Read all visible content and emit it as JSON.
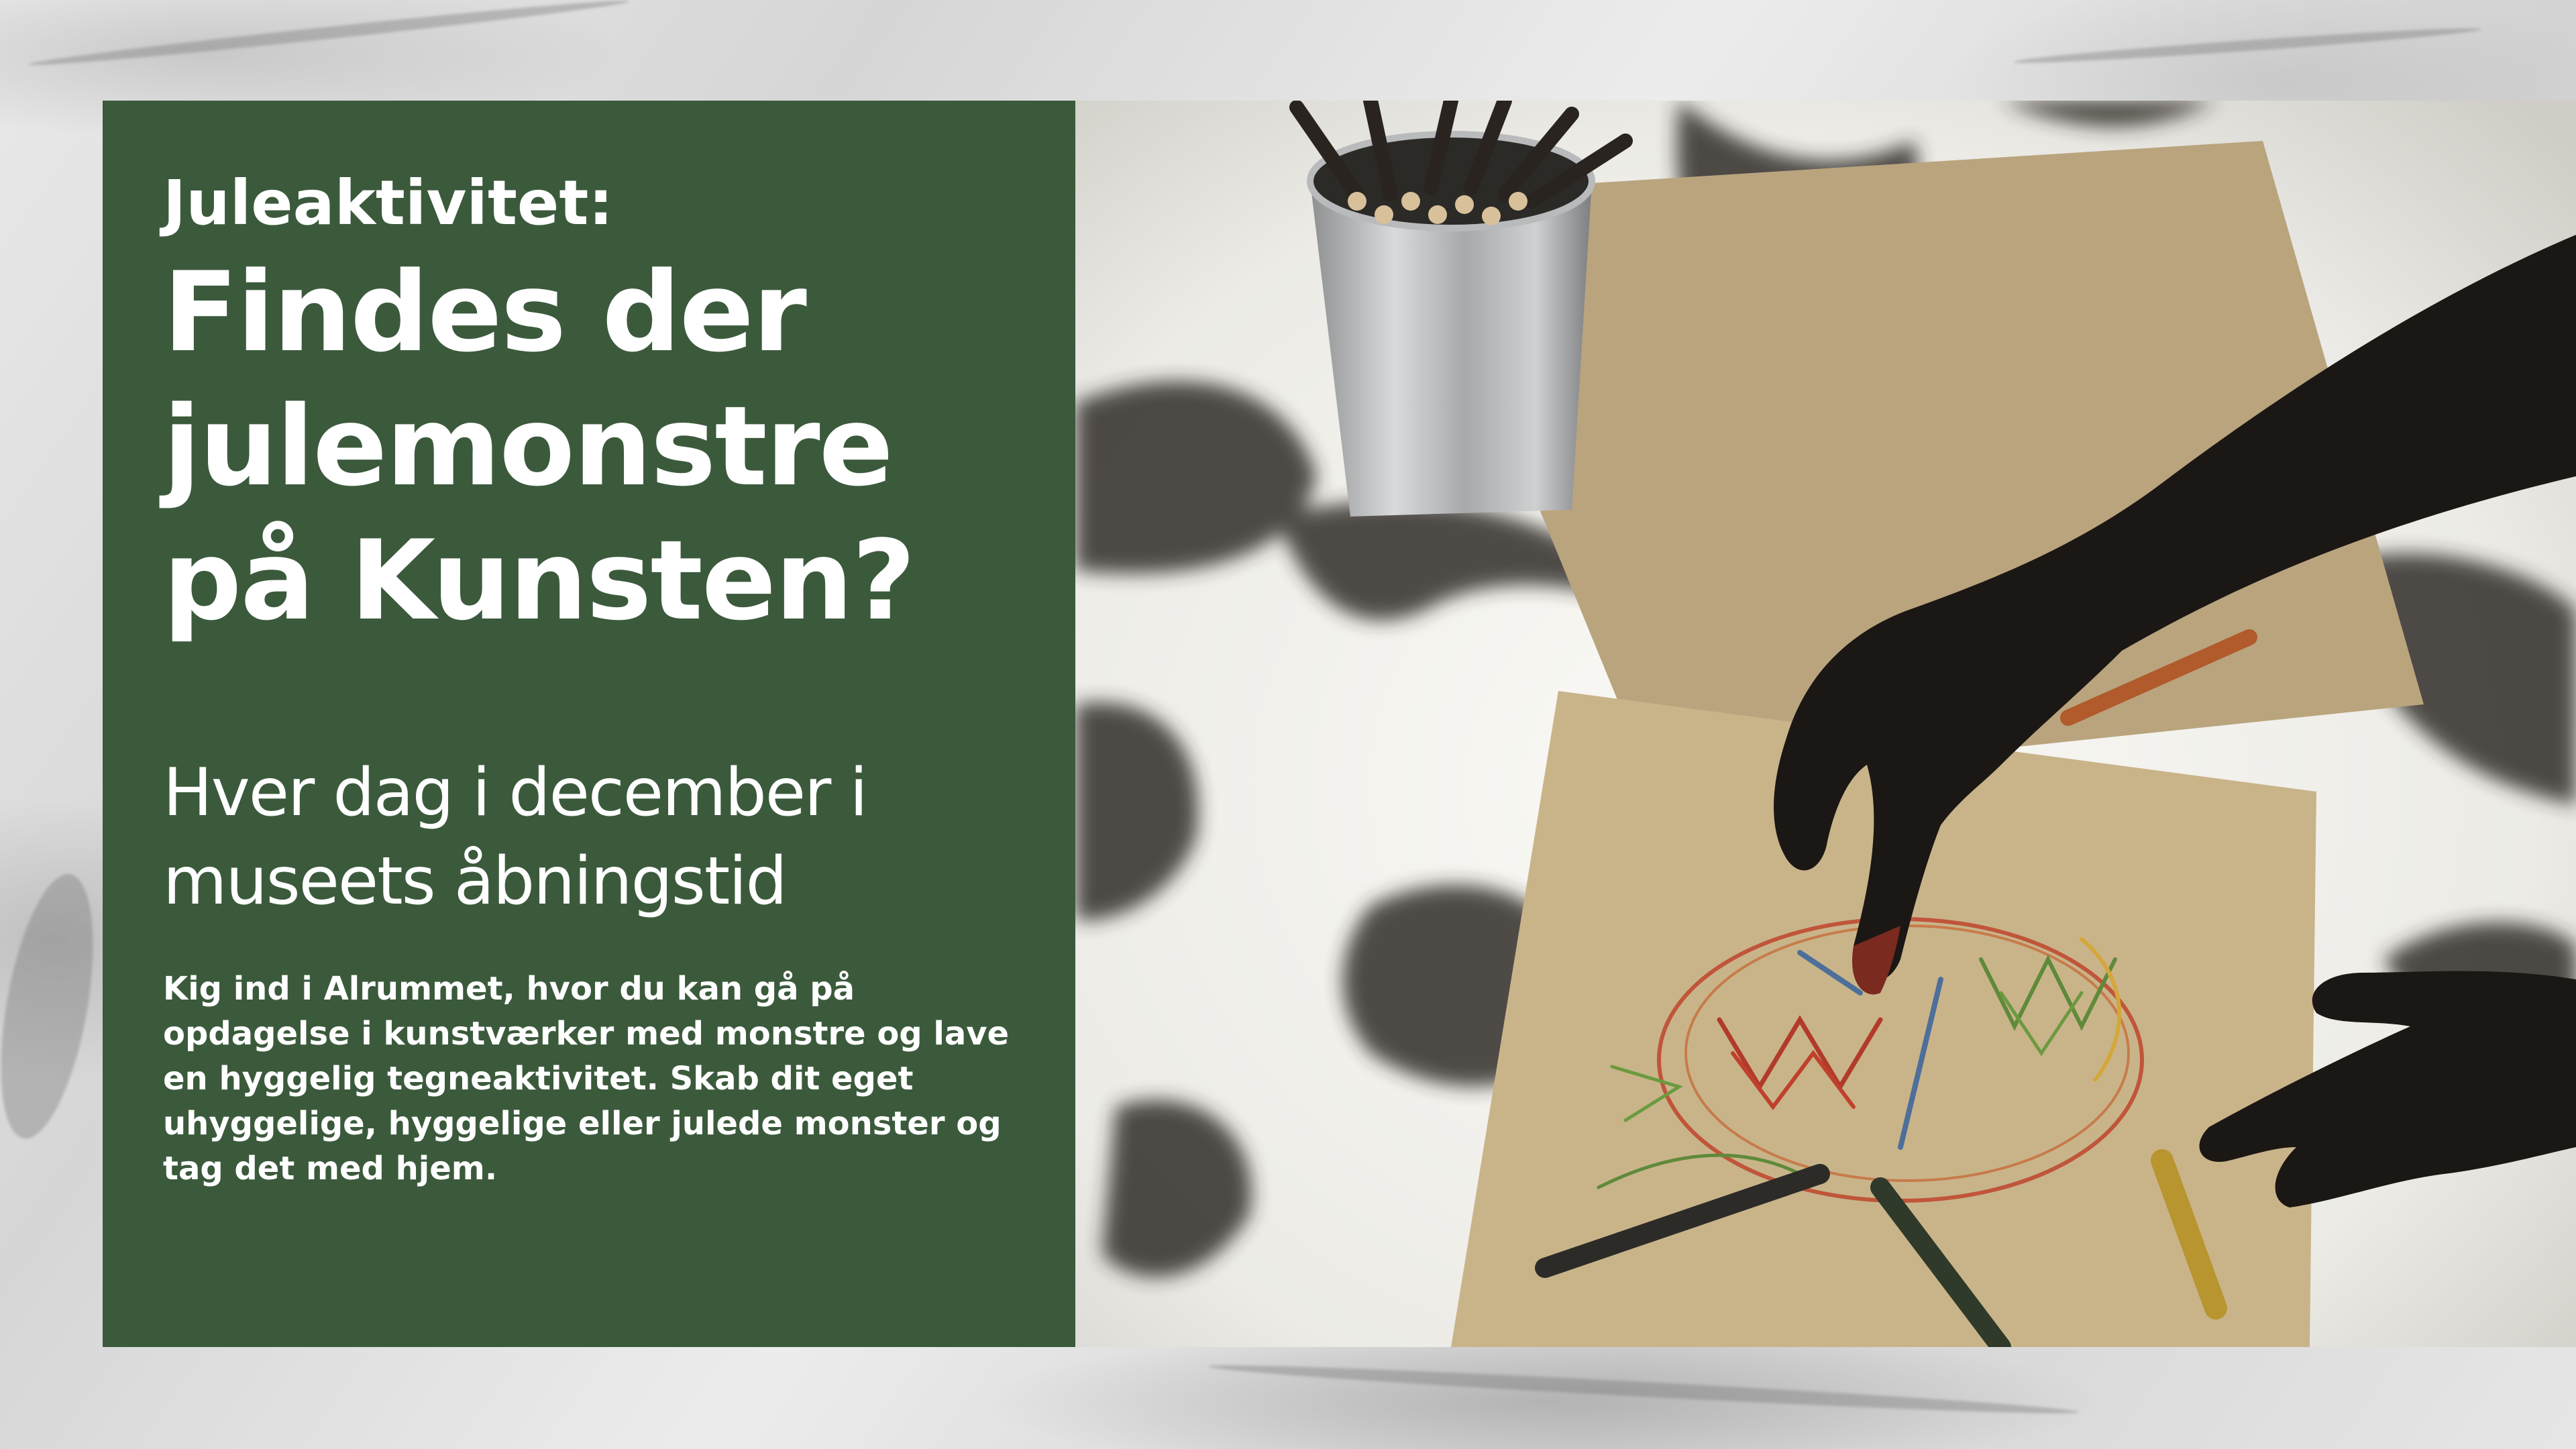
{
  "headline": {
    "kicker": "Juleaktivitet:",
    "title": "Findes der julemonstre på Kunsten?",
    "subtitle": "Hver dag i december i museets åbningstid",
    "body": "Kig ind i Alrummet, hvor du kan gå på opdagelse i kunstværker med monstre og lave en hyggelig tegneaktivitet. Skab dit eget uhyggelige, hyggelige eller julede monster og tag det med hjem."
  },
  "colors": {
    "panel": "#3b5a3c",
    "text": "#ffffff",
    "background": "#dcdcdc"
  }
}
